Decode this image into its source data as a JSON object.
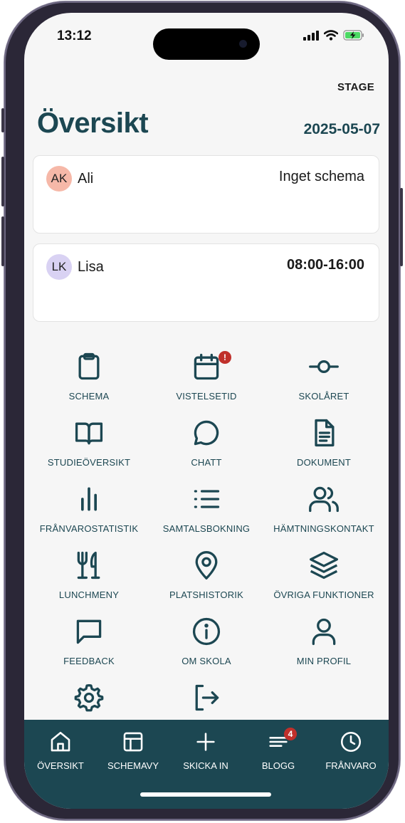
{
  "status_bar": {
    "time": "13:12"
  },
  "header": {
    "env_label": "STAGE",
    "title": "Översikt",
    "date": "2025-05-07"
  },
  "children": [
    {
      "initials": "AK",
      "name": "Ali",
      "schedule": "Inget schema",
      "avatar_color": "#f6b8a8"
    },
    {
      "initials": "LK",
      "name": "Lisa",
      "schedule": "08:00-16:00",
      "avatar_color": "#d9d2f3"
    }
  ],
  "menu": [
    {
      "label": "SCHEMA",
      "icon": "clipboard-icon"
    },
    {
      "label": "VISTELSETID",
      "icon": "calendar-icon",
      "badge": "!"
    },
    {
      "label": "SKOLÅRET",
      "icon": "timeline-icon"
    },
    {
      "label": "STUDIEÖVERSIKT",
      "icon": "book-icon"
    },
    {
      "label": "CHATT",
      "icon": "chat-bubble-icon"
    },
    {
      "label": "DOKUMENT",
      "icon": "document-icon"
    },
    {
      "label": "FRÅNVAROSTATISTIK",
      "icon": "bar-chart-icon"
    },
    {
      "label": "SAMTALSBOKNING",
      "icon": "list-icon"
    },
    {
      "label": "HÄMTNINGSKONTAKT",
      "icon": "users-icon"
    },
    {
      "label": "LUNCHMENY",
      "icon": "cutlery-icon"
    },
    {
      "label": "PLATSHISTORIK",
      "icon": "map-pin-icon"
    },
    {
      "label": "ÖVRIGA FUNKTIONER",
      "icon": "layers-icon"
    },
    {
      "label": "FEEDBACK",
      "icon": "message-square-icon"
    },
    {
      "label": "OM SKOLA",
      "icon": "info-icon"
    },
    {
      "label": "MIN PROFIL",
      "icon": "user-icon"
    },
    {
      "label": "",
      "icon": "gear-icon"
    },
    {
      "label": "",
      "icon": "logout-icon"
    }
  ],
  "tabbar": [
    {
      "label": "ÖVERSIKT",
      "icon": "home-icon"
    },
    {
      "label": "SCHEMAVY",
      "icon": "layout-icon"
    },
    {
      "label": "SKICKA IN",
      "icon": "plus-icon"
    },
    {
      "label": "BLOGG",
      "icon": "lines-icon",
      "badge": "4"
    },
    {
      "label": "FRÅNVARO",
      "icon": "clock-icon"
    }
  ],
  "colors": {
    "primary": "#1c4752",
    "badge": "#c0302b",
    "background": "#f6f6f6"
  }
}
